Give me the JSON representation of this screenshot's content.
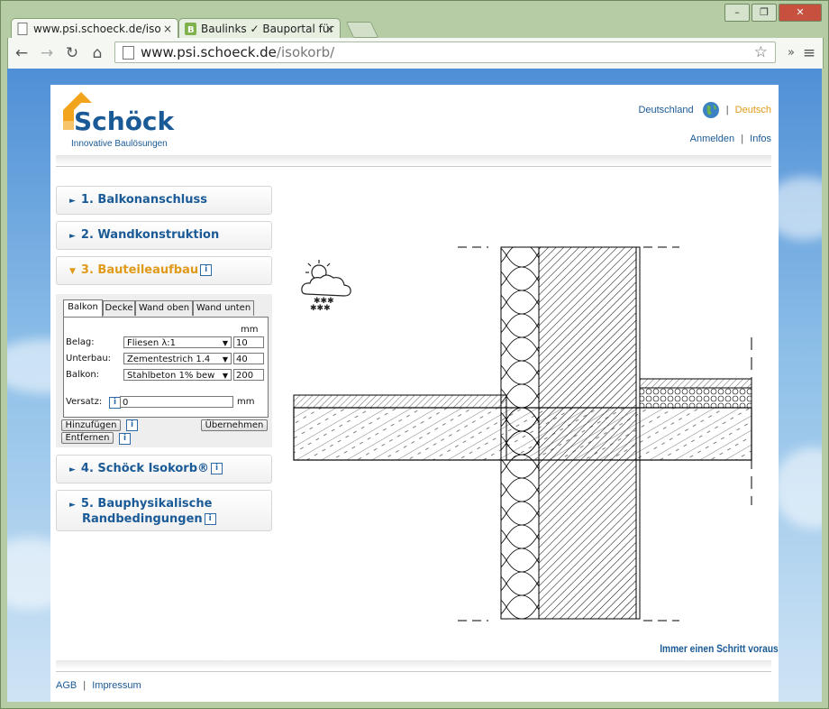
{
  "browser": {
    "tabs": [
      {
        "title": "www.psi.schoeck.de/iso",
        "close": "×"
      },
      {
        "title": "Baulinks ✓ Bauportal für",
        "close": "×"
      }
    ],
    "window_buttons": {
      "minimize": "–",
      "maximize": "❐",
      "close": "✕"
    },
    "url_host": "www.psi.schoeck.de",
    "url_path": "/isokorb/",
    "menu_extra": "»",
    "menu": "≡"
  },
  "header": {
    "logo_name": "Schöck",
    "logo_tagline": "Innovative Baulösungen",
    "country": "Deutschland",
    "language": "Deutsch",
    "login": "Anmelden",
    "infos": "Infos",
    "sep": "|"
  },
  "accordion": [
    {
      "label": "1. Balkonanschluss"
    },
    {
      "label": "2. Wandkonstruktion"
    },
    {
      "label": "3. Bauteileaufbau"
    },
    {
      "label": "4. Schöck Isokorb®"
    },
    {
      "label": "5. Bauphysikalische",
      "label2": "Randbedingungen"
    }
  ],
  "panel": {
    "tabs": [
      "Balkon",
      "Decke",
      "Wand oben",
      "Wand unten"
    ],
    "unit_header": "mm",
    "rows": [
      {
        "label": "Belag:",
        "select": "Fliesen λ:1",
        "value": "10"
      },
      {
        "label": "Unterbau:",
        "select": "Zementestrich 1.4",
        "value": "40"
      },
      {
        "label": "Balkon:",
        "select": "Stahlbeton 1% bew",
        "value": "200"
      }
    ],
    "offset_label": "Versatz:",
    "offset_value": "0",
    "offset_unit": "mm",
    "add_button": "Hinzufügen",
    "apply_button": "Übernehmen",
    "remove_button": "Entfernen",
    "info_glyph": "i"
  },
  "footer": {
    "slogan": "Immer einen Schritt voraus",
    "links": [
      "AGB",
      "Impressum"
    ],
    "sep": "|"
  },
  "colors": {
    "brand_blue": "#1a5a96",
    "accent_orange": "#e09a1a"
  }
}
